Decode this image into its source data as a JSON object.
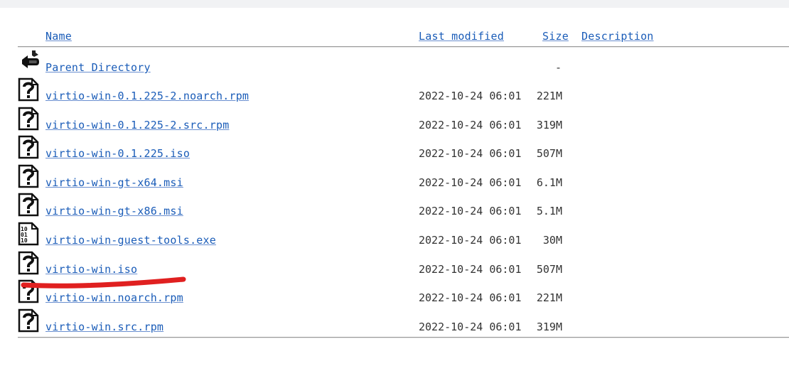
{
  "header": {
    "name": "Name",
    "last_modified": "Last modified",
    "size": "Size",
    "description": "Description"
  },
  "parent": {
    "label": "Parent Directory",
    "size": "-"
  },
  "rows": [
    {
      "name": "virtio-win-0.1.225-2.noarch.rpm",
      "modified": "2022-10-24 06:01",
      "size": "221M",
      "icon": "unknown-file-icon"
    },
    {
      "name": "virtio-win-0.1.225-2.src.rpm",
      "modified": "2022-10-24 06:01",
      "size": "319M",
      "icon": "unknown-file-icon"
    },
    {
      "name": "virtio-win-0.1.225.iso",
      "modified": "2022-10-24 06:01",
      "size": "507M",
      "icon": "unknown-file-icon"
    },
    {
      "name": "virtio-win-gt-x64.msi",
      "modified": "2022-10-24 06:01",
      "size": "6.1M",
      "icon": "unknown-file-icon"
    },
    {
      "name": "virtio-win-gt-x86.msi",
      "modified": "2022-10-24 06:01",
      "size": "5.1M",
      "icon": "unknown-file-icon"
    },
    {
      "name": "virtio-win-guest-tools.exe",
      "modified": "2022-10-24 06:01",
      "size": "30M",
      "icon": "binary-file-icon"
    },
    {
      "name": "virtio-win.iso",
      "modified": "2022-10-24 06:01",
      "size": "507M",
      "icon": "unknown-file-icon"
    },
    {
      "name": "virtio-win.noarch.rpm",
      "modified": "2022-10-24 06:01",
      "size": "221M",
      "icon": "unknown-file-icon"
    },
    {
      "name": "virtio-win.src.rpm",
      "modified": "2022-10-24 06:01",
      "size": "319M",
      "icon": "unknown-file-icon"
    }
  ],
  "colors": {
    "link": "#1a5cb8",
    "annotation": "#e02020"
  }
}
